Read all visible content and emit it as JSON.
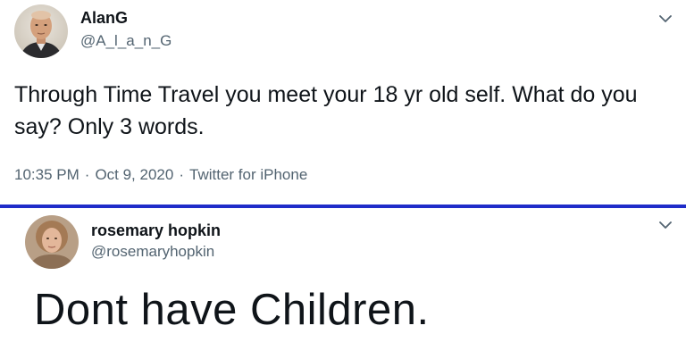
{
  "tweets": [
    {
      "display_name": "AlanG",
      "handle": "@A_l_a_n_G",
      "text": "Through Time Travel you meet your 18 yr old self. What do you say? Only 3 words.",
      "time": "10:35 PM",
      "date": "Oct 9, 2020",
      "source": "Twitter for iPhone",
      "separator": "·"
    },
    {
      "display_name": "rosemary hopkin",
      "handle": "@rosemaryhopkin",
      "text": "Dont have Children."
    }
  ],
  "colors": {
    "text": "#0f1419",
    "secondary_text": "#536471",
    "divider": "#1f2cc9",
    "background": "#ffffff"
  },
  "icons": {
    "menu": "chevron-down-icon",
    "avatar": "avatar"
  }
}
